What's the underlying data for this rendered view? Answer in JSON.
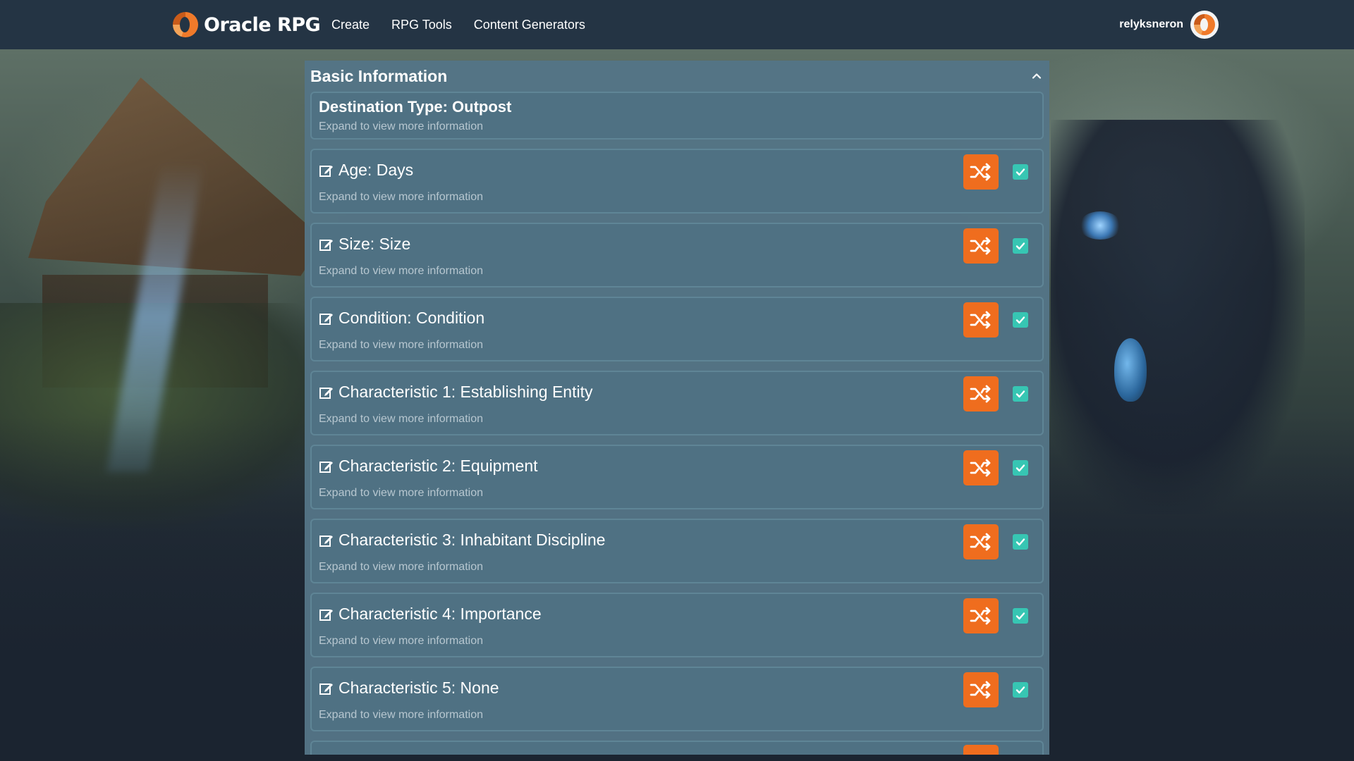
{
  "brand": {
    "name": "Oracle RPG",
    "logo_icon": "oracle-logo-icon"
  },
  "nav": {
    "links": [
      "Create",
      "RPG Tools",
      "Content Generators"
    ]
  },
  "user": {
    "name": "relyksneron"
  },
  "colors": {
    "navbar": "#243444",
    "panel": "#547586",
    "accent_orange": "#ef6d1e",
    "checkbox_teal": "#37c6b3"
  },
  "panel": {
    "title": "Basic Information",
    "destination": {
      "title": "Destination Type: Outpost",
      "subtitle": "Expand to view more information"
    },
    "items": [
      {
        "title": "Age: Days",
        "subtitle": "Expand to view more information",
        "checked": true
      },
      {
        "title": "Size: Size",
        "subtitle": "Expand to view more information",
        "checked": true
      },
      {
        "title": "Condition: Condition",
        "subtitle": "Expand to view more information",
        "checked": true
      },
      {
        "title": "Characteristic 1: Establishing Entity",
        "subtitle": "Expand to view more information",
        "checked": true
      },
      {
        "title": "Characteristic 2: Equipment",
        "subtitle": "Expand to view more information",
        "checked": true
      },
      {
        "title": "Characteristic 3: Inhabitant Discipline",
        "subtitle": "Expand to view more information",
        "checked": true
      },
      {
        "title": "Characteristic 4: Importance",
        "subtitle": "Expand to view more information",
        "checked": true
      },
      {
        "title": "Characteristic 5: None",
        "subtitle": "Expand to view more information",
        "checked": true
      }
    ]
  }
}
